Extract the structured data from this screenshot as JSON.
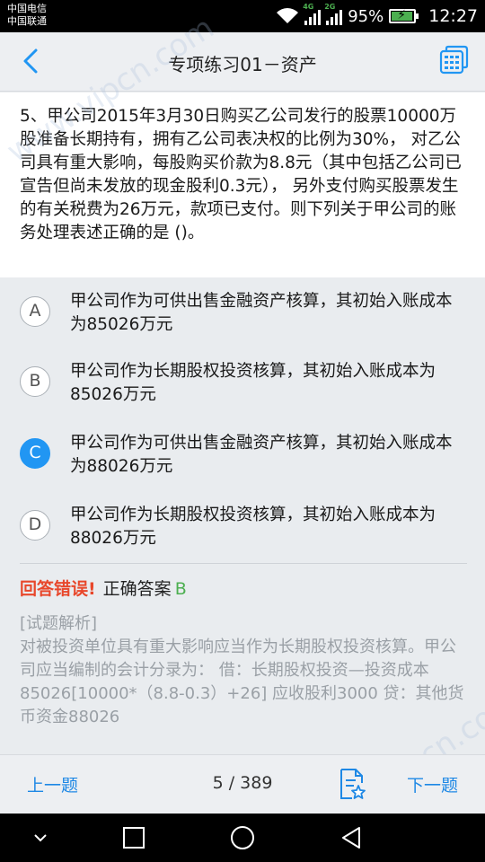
{
  "status_bar": {
    "carrier_1": "中国电信",
    "carrier_2": "中国联通",
    "network_1": "4G",
    "network_2": "2G",
    "battery": "95%",
    "time": "12:27"
  },
  "header": {
    "title": "专项练习01－资产",
    "back_icon": "chevron-left-icon",
    "right_icon": "answer-sheet-icon"
  },
  "question": {
    "text": "5、甲公司2015年3月30日购买乙公司发行的股票10000万股准备长期持有，拥有乙公司表决权的比例为30%， 对乙公司具有重大影响，每股购买价款为8.8元（其中包括乙公司已宣告但尚未发放的现金股利0.3元）， 另外支付购买股票发生的有关税费为26万元，款项已支付。则下列关于甲公司的账务处理表述正确的是 ()。"
  },
  "options": [
    {
      "letter": "A",
      "text": "甲公司作为可供出售金融资产核算，其初始入账成本为85026万元"
    },
    {
      "letter": "B",
      "text": "甲公司作为长期股权投资核算，其初始入账成本为85026万元"
    },
    {
      "letter": "C",
      "text": "甲公司作为可供出售金融资产核算，其初始入账成本为88026万元"
    },
    {
      "letter": "D",
      "text": "甲公司作为长期股权投资核算，其初始入账成本为88026万元"
    }
  ],
  "selected_option": "C",
  "result": {
    "status": "回答错误!",
    "correct_label": "正确答案",
    "correct_value": "B"
  },
  "analysis": {
    "heading": "[试题解析]",
    "text": "对被投资单位具有重大影响应当作为长期股权投资核算。甲公司应当编制的会计分录为： 借：长期股权投资—投资成本85026[10000*（8.8-0.3）+26] 应收股利3000 贷：其他货币资金88026"
  },
  "bottom_bar": {
    "prev": "上一题",
    "page": "5 / 389",
    "next": "下一题",
    "favorite_icon": "favorite-note-icon"
  },
  "watermark": "www.vipcn.com",
  "colors": {
    "accent": "#2196f3",
    "wrong": "#e8472b",
    "correct": "#4caf50",
    "link": "#1e88e5"
  }
}
